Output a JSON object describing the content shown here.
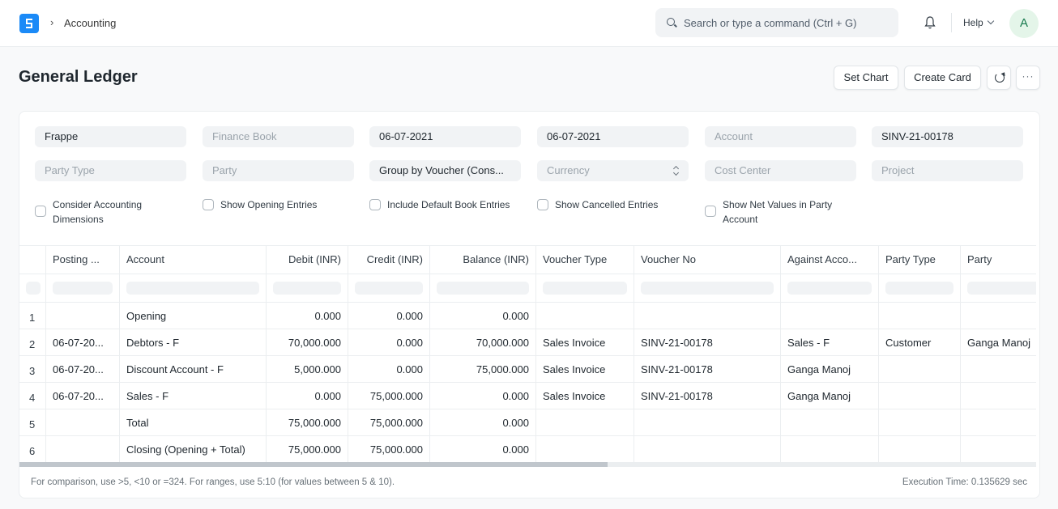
{
  "navbar": {
    "breadcrumb_sep": "›",
    "breadcrumb": "Accounting",
    "search_placeholder": "Search or type a command (Ctrl + G)",
    "help_label": "Help",
    "avatar_initial": "A"
  },
  "page": {
    "title": "General Ledger",
    "buttons": {
      "set_chart": "Set Chart",
      "create_card": "Create Card",
      "more": "···"
    }
  },
  "filters": {
    "company": {
      "value": "Frappe"
    },
    "finance_book": {
      "placeholder": "Finance Book"
    },
    "from_date": {
      "value": "06-07-2021"
    },
    "to_date": {
      "value": "06-07-2021"
    },
    "account": {
      "placeholder": "Account"
    },
    "voucher_no": {
      "value": "SINV-21-00178"
    },
    "party_type": {
      "placeholder": "Party Type"
    },
    "party": {
      "placeholder": "Party"
    },
    "group_by": {
      "value": "Group by Voucher (Cons..."
    },
    "currency": {
      "placeholder": "Currency"
    },
    "cost_center": {
      "placeholder": "Cost Center"
    },
    "project": {
      "placeholder": "Project"
    }
  },
  "checkboxes": [
    {
      "label_line1": "Consider Accounting",
      "label_line2": "Dimensions",
      "checked": false
    },
    {
      "label_line1": "Show Opening Entries",
      "label_line2": "",
      "checked": false
    },
    {
      "label_line1": "Include Default Book Entries",
      "label_line2": "",
      "checked": false
    },
    {
      "label_line1": "Show Cancelled Entries",
      "label_line2": "",
      "checked": false
    },
    {
      "label_line1": "Show Net Values in Party",
      "label_line2": "Account",
      "checked": false
    }
  ],
  "table": {
    "columns": [
      "",
      "Posting ...",
      "Account",
      "Debit (INR)",
      "Credit (INR)",
      "Balance (INR)",
      "Voucher Type",
      "Voucher No",
      "Against Acco...",
      "Party Type",
      "Party"
    ],
    "rows": [
      [
        "1",
        "",
        "Opening",
        "0.000",
        "0.000",
        "0.000",
        "",
        "",
        "",
        "",
        ""
      ],
      [
        "2",
        "06-07-20...",
        "Debtors - F",
        "70,000.000",
        "0.000",
        "70,000.000",
        "Sales Invoice",
        "SINV-21-00178",
        "Sales - F",
        "Customer",
        "Ganga Manoj"
      ],
      [
        "3",
        "06-07-20...",
        "Discount Account - F",
        "5,000.000",
        "0.000",
        "75,000.000",
        "Sales Invoice",
        "SINV-21-00178",
        "Ganga Manoj",
        "",
        ""
      ],
      [
        "4",
        "06-07-20...",
        "Sales - F",
        "0.000",
        "75,000.000",
        "0.000",
        "Sales Invoice",
        "SINV-21-00178",
        "Ganga Manoj",
        "",
        ""
      ],
      [
        "5",
        "",
        "Total",
        "75,000.000",
        "75,000.000",
        "0.000",
        "",
        "",
        "",
        "",
        ""
      ],
      [
        "6",
        "",
        "Closing (Opening + Total)",
        "75,000.000",
        "75,000.000",
        "0.000",
        "",
        "",
        "",
        "",
        ""
      ]
    ]
  },
  "footer": {
    "hint": "For comparison, use >5, <10 or =324. For ranges, use 5:10 (for values between 5 & 10).",
    "execution_time": "Execution Time: 0.135629 sec"
  }
}
